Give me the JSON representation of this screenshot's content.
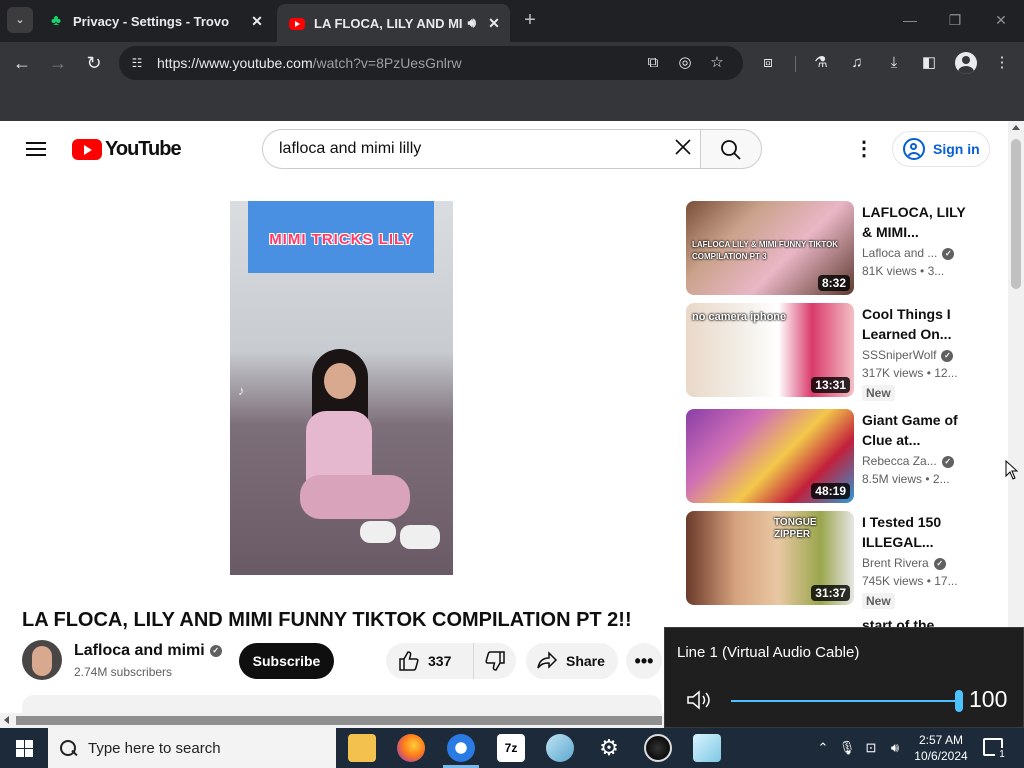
{
  "browser": {
    "tabs": [
      {
        "title": "Privacy - Settings - Trovo",
        "close": "✕"
      },
      {
        "title": "LA FLOCA, LILY AND MIMI",
        "close": "✕"
      }
    ],
    "new_tab": "+",
    "url_host": "https://www.youtube.com",
    "url_path": "/watch?v=8PzUesGnlrw"
  },
  "youtube": {
    "logo": "YouTube",
    "search": {
      "value": "lafloca and mimi lilly",
      "clear": "✕"
    },
    "sign_in": "Sign in",
    "player": {
      "overlay_text": "MIMI TRICKS LILY"
    },
    "video": {
      "title": "LA FLOCA, LILY AND MIMI FUNNY TIKTOK COMPILATION PT 2!!",
      "channel": "Lafloca and mimi",
      "subscribers": "2.74M subscribers",
      "subscribe": "Subscribe",
      "likes": "337",
      "share": "Share",
      "more": "•••"
    },
    "recommendations": [
      {
        "title": "LAFLOCA, LILY & MIMI...",
        "channel": "Lafloca and ...",
        "views": "81K views",
        "age": "• 3...",
        "duration": "8:32",
        "badge": "",
        "thumb_caption": "LAFLOCA LILY & MIMI FUNNY TIKTOK COMPILATION PT 3"
      },
      {
        "title": "Cool Things I Learned On...",
        "channel": "SSSniperWolf",
        "views": "317K views",
        "age": "• 12...",
        "duration": "13:31",
        "badge": "New",
        "thumb_caption": "no camera iphone"
      },
      {
        "title": "Giant Game of Clue at...",
        "channel": "Rebecca Za...",
        "views": "8.5M views",
        "age": "• 2...",
        "duration": "48:19",
        "badge": "",
        "thumb_caption": ""
      },
      {
        "title": "I Tested 150 ILLEGAL...",
        "channel": "Brent Rivera",
        "views": "745K views",
        "age": "• 17...",
        "duration": "31:37",
        "badge": "New",
        "thumb_caption": "TONGUE ZIPPER"
      }
    ],
    "next_title_partial": "start of the"
  },
  "volume": {
    "device": "Line 1 (Virtual Audio Cable)",
    "level": 100,
    "level_label": "100",
    "accent": "#4cc2ff"
  },
  "taskbar": {
    "search_placeholder": "Type here to search",
    "time": "2:57 AM",
    "date": "10/6/2024",
    "notifications": "1"
  }
}
